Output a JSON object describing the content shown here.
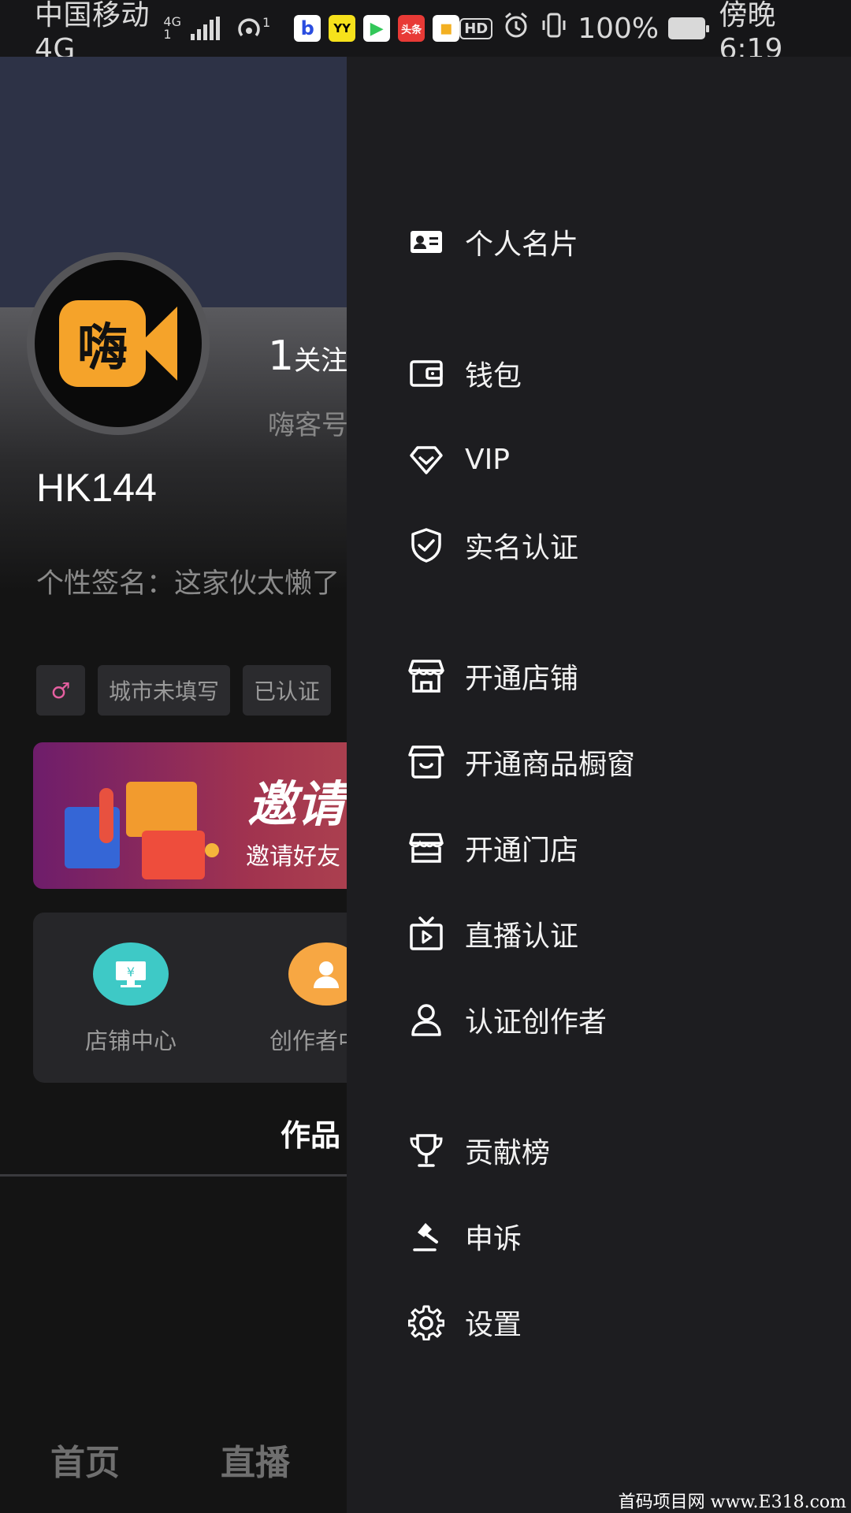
{
  "status_bar": {
    "carrier": "中国移动4G",
    "net_top": "4G",
    "net_bottom": "1",
    "hotspot_count": "1",
    "app_icons": [
      {
        "name": "baidu-app-icon",
        "text": "b",
        "color": "#ffffff"
      },
      {
        "name": "yy-app-icon",
        "text": "YY",
        "color": "#f6e11b"
      },
      {
        "name": "video-app-icon",
        "text": "▶",
        "color": "#33c759"
      },
      {
        "name": "toutiao-app-icon",
        "text": "头条",
        "color": "#e83a36"
      },
      {
        "name": "store-app-icon",
        "text": "▪",
        "color": "#f3b022"
      }
    ],
    "hd": "HD",
    "battery": "100%",
    "time": "傍晚6:19"
  },
  "profile": {
    "logo_text": "嗨",
    "follow_count": "1",
    "follow_label": "关注",
    "id_label": "嗨客号",
    "username": "HK144",
    "signature": "个性签名：这家伙太懒了",
    "tags": [
      "♂",
      "城市未填写",
      "已认证"
    ],
    "banner_title": "邀请",
    "banner_sub": "邀请好友",
    "quick_items": [
      "店铺中心",
      "创作者中"
    ],
    "works_tab": "作品"
  },
  "bottom_nav": {
    "home": "首页",
    "live": "直播"
  },
  "drawer": {
    "items": [
      {
        "icon": "id-card-icon",
        "label": "个人名片"
      },
      {
        "icon": "wallet-icon",
        "label": "钱包"
      },
      {
        "icon": "diamond-icon",
        "label": "VIP"
      },
      {
        "icon": "shield-check-icon",
        "label": "实名认证"
      },
      {
        "icon": "shop-icon",
        "label": "开通店铺"
      },
      {
        "icon": "showcase-icon",
        "label": "开通商品橱窗"
      },
      {
        "icon": "store-front-icon",
        "label": "开通门店"
      },
      {
        "icon": "tv-live-icon",
        "label": "直播认证"
      },
      {
        "icon": "user-icon",
        "label": "认证创作者"
      },
      {
        "icon": "trophy-icon",
        "label": "贡献榜"
      },
      {
        "icon": "gavel-icon",
        "label": "申诉"
      },
      {
        "icon": "gear-icon",
        "label": "设置"
      }
    ]
  },
  "watermark": "首码项目网 www.E318.com",
  "colors": {
    "drawer_bg": "#1d1d20",
    "cover_bg": "#2d3246",
    "logo_orange": "#f5a32a",
    "shop_teal": "#3ec9c6",
    "creator_orange": "#f7a743"
  }
}
